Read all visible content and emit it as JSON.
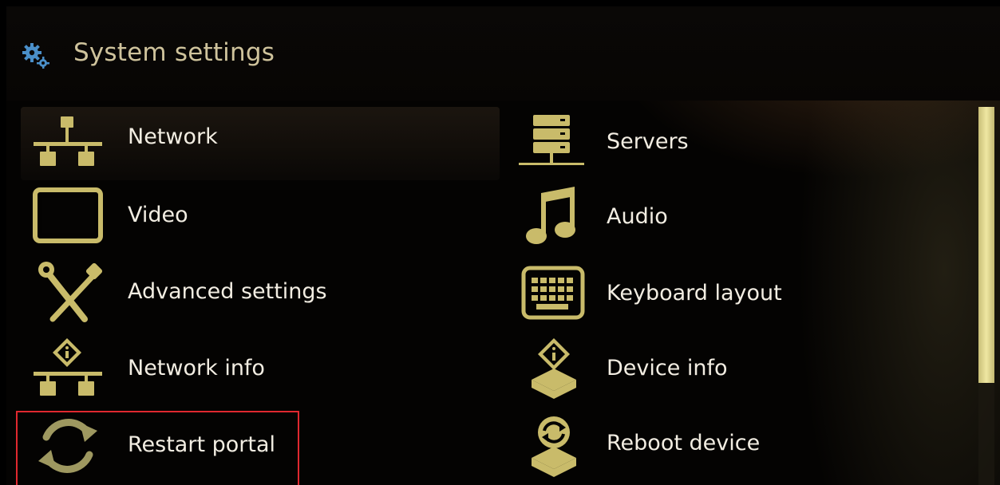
{
  "header": {
    "title": "System settings",
    "icon": "gears-icon"
  },
  "menu": {
    "left": [
      {
        "label": "Network",
        "icon": "network-icon"
      },
      {
        "label": "Video",
        "icon": "monitor-icon"
      },
      {
        "label": "Advanced settings",
        "icon": "tools-icon"
      },
      {
        "label": "Network info",
        "icon": "network-info-icon"
      },
      {
        "label": "Restart portal",
        "icon": "restart-icon"
      }
    ],
    "right": [
      {
        "label": "Servers",
        "icon": "server-icon"
      },
      {
        "label": "Audio",
        "icon": "music-note-icon"
      },
      {
        "label": "Keyboard layout",
        "icon": "keyboard-icon"
      },
      {
        "label": "Device info",
        "icon": "device-info-icon"
      },
      {
        "label": "Reboot device",
        "icon": "reboot-icon"
      }
    ],
    "focused": "Network",
    "highlighted": "Restart portal"
  },
  "scrollbar": {
    "position_fraction": 0.0,
    "visible_fraction": 0.73
  },
  "colors": {
    "icon_gold": "#c9bb6a",
    "title_color": "#cfc39c",
    "highlight_border": "#e0282f",
    "gear_blue": "#4a8fc9"
  }
}
